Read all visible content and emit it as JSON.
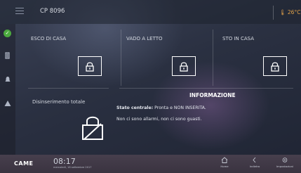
{
  "topbar": {
    "device_name": "CP 8096",
    "temperature": "🌡 26°C"
  },
  "sidebar": {
    "icons": [
      "status-ok-icon",
      "camera-icon",
      "bell-icon",
      "warning-icon"
    ]
  },
  "scenarios": [
    {
      "label": "ESCO DI CASA",
      "icon": "lock-icon"
    },
    {
      "label": "VADO A LETTO",
      "icon": "lock-icon"
    },
    {
      "label": "STO IN CASA",
      "icon": "lock-icon"
    }
  ],
  "disarm": {
    "label": "Disinserimento totale",
    "icon": "unlock-crossed-icon"
  },
  "info": {
    "title": "INFORMAZIONE",
    "status_label": "Stato centrale:",
    "status_value": "Pronta e NON INSERITA.",
    "message": "Non ci sono allarmi, non ci sono guasti."
  },
  "pager": {
    "total": 3,
    "active": 1
  },
  "bottombar": {
    "brand": "CAME",
    "time": "08:17",
    "date": "mercoledì, 16 settembre 2017",
    "nav": [
      {
        "label": "Home",
        "icon": "home-icon"
      },
      {
        "label": "Indietro",
        "icon": "back-icon"
      },
      {
        "label": "Impostazioni",
        "icon": "settings-icon"
      }
    ]
  },
  "colors": {
    "accent_temp": "#e6a34a",
    "status_ok": "#4caa3f"
  }
}
